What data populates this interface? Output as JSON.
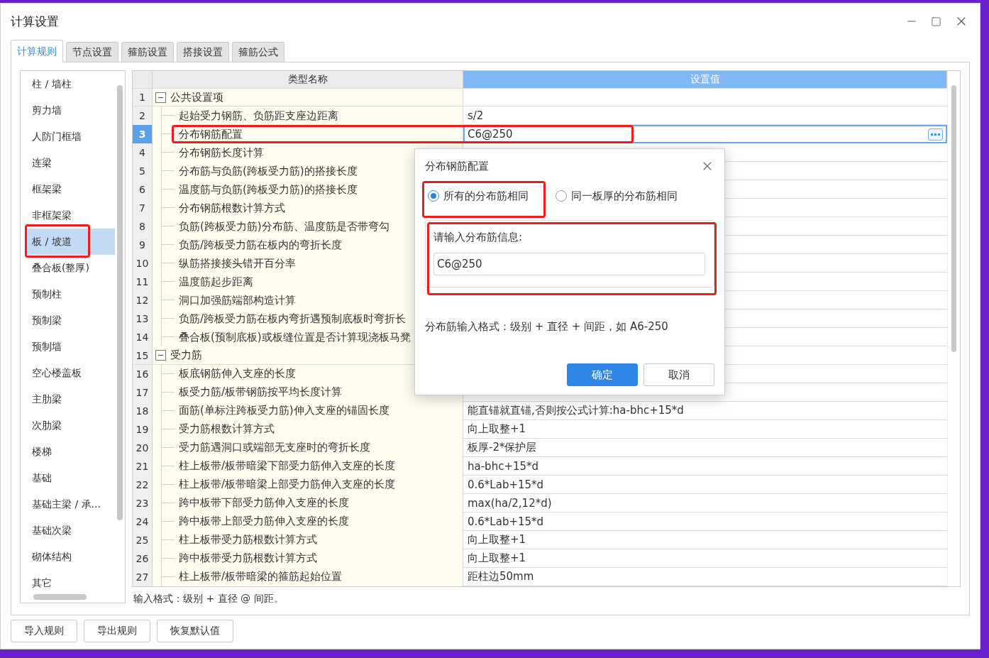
{
  "window": {
    "title": "计算设置"
  },
  "tabs": [
    {
      "label": "计算规则",
      "selected": true
    },
    {
      "label": "节点设置",
      "selected": false
    },
    {
      "label": "箍筋设置",
      "selected": false
    },
    {
      "label": "搭接设置",
      "selected": false
    },
    {
      "label": "箍筋公式",
      "selected": false
    }
  ],
  "sidebar": {
    "items": [
      {
        "label": "柱 / 墙柱",
        "selected": false
      },
      {
        "label": "剪力墙",
        "selected": false
      },
      {
        "label": "人防门框墙",
        "selected": false
      },
      {
        "label": "连梁",
        "selected": false
      },
      {
        "label": "框架梁",
        "selected": false
      },
      {
        "label": "非框架梁",
        "selected": false
      },
      {
        "label": "板 / 坡道",
        "selected": true,
        "highlighted": true
      },
      {
        "label": "叠合板(整厚)",
        "selected": false
      },
      {
        "label": "预制柱",
        "selected": false
      },
      {
        "label": "预制梁",
        "selected": false
      },
      {
        "label": "预制墙",
        "selected": false
      },
      {
        "label": "空心楼盖板",
        "selected": false
      },
      {
        "label": "主肋梁",
        "selected": false
      },
      {
        "label": "次肋梁",
        "selected": false
      },
      {
        "label": "楼梯",
        "selected": false
      },
      {
        "label": "基础",
        "selected": false
      },
      {
        "label": "基础主梁 / 承...",
        "selected": false
      },
      {
        "label": "基础次梁",
        "selected": false
      },
      {
        "label": "砌体结构",
        "selected": false
      },
      {
        "label": "其它",
        "selected": false
      }
    ]
  },
  "table": {
    "columns": [
      "类型名称",
      "设置值"
    ],
    "rows": [
      {
        "number": "1",
        "name": "公共设置项",
        "kind": "group",
        "expanded": true,
        "selected": false,
        "children": [
          {
            "number": "2",
            "name": "起始受力钢筋、负筋距支座边距离",
            "value": "s/2",
            "kind": "item",
            "selected": false
          },
          {
            "number": "3",
            "name": "分布钢筋配置",
            "value": "C6@250",
            "kind": "item",
            "selected": true,
            "highlighted": true
          },
          {
            "number": "4",
            "name": "分布钢筋长度计算",
            "kind": "item",
            "selected": false
          },
          {
            "number": "5",
            "name": "分布筋与负筋(跨板受力筋)的搭接长度",
            "kind": "item",
            "selected": false
          },
          {
            "number": "6",
            "name": "温度筋与负筋(跨板受力筋)的搭接长度",
            "kind": "item",
            "selected": false
          },
          {
            "number": "7",
            "name": "分布钢筋根数计算方式",
            "kind": "item",
            "selected": false
          },
          {
            "number": "8",
            "name": "负筋(跨板受力筋)分布筋、温度筋是否带弯勾",
            "kind": "item",
            "selected": false
          },
          {
            "number": "9",
            "name": "负筋/跨板受力筋在板内的弯折长度",
            "kind": "item",
            "selected": false
          },
          {
            "number": "10",
            "name": "纵筋搭接接头错开百分率",
            "kind": "item",
            "selected": false
          },
          {
            "number": "11",
            "name": "温度筋起步距离",
            "kind": "item",
            "selected": false
          },
          {
            "number": "12",
            "name": "洞口加强筋端部构造计算",
            "kind": "item",
            "selected": false
          },
          {
            "number": "13",
            "name": "负筋/跨板受力筋在板内弯折遇预制底板时弯折长",
            "kind": "item",
            "selected": false
          },
          {
            "number": "14",
            "name": "叠合板(预制底板)或板缝位置是否计算现浇板马凳",
            "kind": "item",
            "selected": false
          }
        ]
      },
      {
        "number": "15",
        "name": "受力筋",
        "kind": "group",
        "expanded": true,
        "selected": false,
        "children": [
          {
            "number": "16",
            "name": "板底钢筋伸入支座的长度",
            "kind": "item",
            "selected": false
          },
          {
            "number": "17",
            "name": "板受力筋/板带钢筋按平均长度计算",
            "kind": "item",
            "selected": false
          },
          {
            "number": "18",
            "name": "面筋(单标注跨板受力筋)伸入支座的锚固长度",
            "value": "能直锚就直锚,否则按公式计算:ha-bhc+15*d",
            "kind": "item",
            "selected": false
          },
          {
            "number": "19",
            "name": "受力筋根数计算方式",
            "value": "向上取整+1",
            "kind": "item",
            "selected": false
          },
          {
            "number": "20",
            "name": "受力筋遇洞口或端部无支座时的弯折长度",
            "value": "板厚-2*保护层",
            "kind": "item",
            "selected": false
          },
          {
            "number": "21",
            "name": "柱上板带/板带暗梁下部受力筋伸入支座的长度",
            "value": "ha-bhc+15*d",
            "kind": "item",
            "selected": false
          },
          {
            "number": "22",
            "name": "柱上板带/板带暗梁上部受力筋伸入支座的长度",
            "value": "0.6*Lab+15*d",
            "kind": "item",
            "selected": false
          },
          {
            "number": "23",
            "name": "跨中板带下部受力筋伸入支座的长度",
            "value": "max(ha/2,12*d)",
            "kind": "item",
            "selected": false
          },
          {
            "number": "24",
            "name": "跨中板带上部受力筋伸入支座的长度",
            "value": "0.6*Lab+15*d",
            "kind": "item",
            "selected": false
          },
          {
            "number": "25",
            "name": "柱上板带受力筋根数计算方式",
            "value": "向上取整+1",
            "kind": "item",
            "selected": false
          },
          {
            "number": "26",
            "name": "跨中板带受力筋根数计算方式",
            "value": "向上取整+1",
            "kind": "item",
            "selected": false
          },
          {
            "number": "27",
            "name": "柱上板带/板带暗梁的箍筋起始位置",
            "value": "距柱边50mm",
            "kind": "item",
            "selected": false
          }
        ]
      }
    ]
  },
  "hint": "输入格式：级别 + 直径 @ 间距。",
  "buttons": [
    "导入规则",
    "导出规则",
    "恢复默认值"
  ],
  "dialog": {
    "title": "分布钢筋配置",
    "options": [
      {
        "label": "所有的分布筋相同",
        "selected": true,
        "highlighted": true
      },
      {
        "label": "同一板厚的分布筋相同",
        "selected": false
      }
    ],
    "group": {
      "label": "请输入分布筋信息:",
      "value": "C6@250",
      "highlighted": true
    },
    "note": "分布筋输入格式：级别 + 直径 + 间距，如 A6-250",
    "buttons": [
      {
        "label": "确定",
        "kind": "primary"
      },
      {
        "label": "取消",
        "kind": "secondary"
      }
    ]
  }
}
